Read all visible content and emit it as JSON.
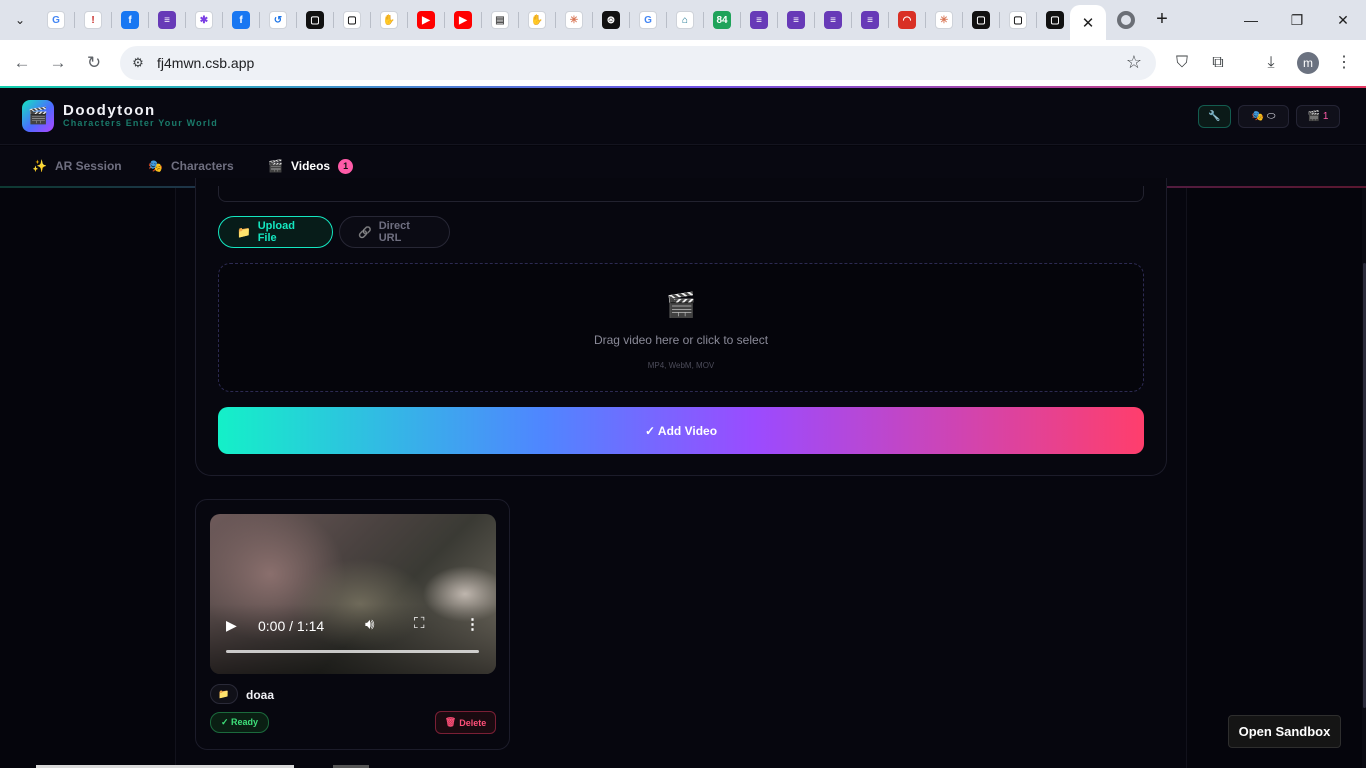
{
  "browser": {
    "tab_icons": [
      {
        "name": "google-icon",
        "glyph": "G",
        "bg": "#ffffff",
        "fg": "#4285f4"
      },
      {
        "name": "alert-icon",
        "glyph": "!",
        "bg": "#ffffff",
        "fg": "#c5221f"
      },
      {
        "name": "facebook-icon",
        "glyph": "f",
        "bg": "#1877f2",
        "fg": "#ffffff"
      },
      {
        "name": "forms-icon",
        "glyph": "≡",
        "bg": "#673ab7",
        "fg": "#ffffff"
      },
      {
        "name": "bug-icon",
        "glyph": "✱",
        "bg": "#ffffff",
        "fg": "#7b3fe4"
      },
      {
        "name": "facebook-icon",
        "glyph": "f",
        "bg": "#1877f2",
        "fg": "#ffffff"
      },
      {
        "name": "history-icon",
        "glyph": "↺",
        "bg": "#ffffff",
        "fg": "#1a73e8"
      },
      {
        "name": "square-icon",
        "glyph": "▢",
        "bg": "#111111",
        "fg": "#ffffff"
      },
      {
        "name": "square-outline-icon",
        "glyph": "▢",
        "bg": "#ffffff",
        "fg": "#111111"
      },
      {
        "name": "hand-icon",
        "glyph": "✋",
        "bg": "#ffffff",
        "fg": "#111111"
      },
      {
        "name": "youtube-icon",
        "glyph": "▶",
        "bg": "#ff0000",
        "fg": "#ffffff"
      },
      {
        "name": "youtube-icon",
        "glyph": "▶",
        "bg": "#ff0000",
        "fg": "#ffffff"
      },
      {
        "name": "archive-icon",
        "glyph": "▤",
        "bg": "#ffffff",
        "fg": "#555555"
      },
      {
        "name": "hand-icon",
        "glyph": "✋",
        "bg": "#ffffff",
        "fg": "#111111"
      },
      {
        "name": "claude-icon",
        "glyph": "✳",
        "bg": "#ffffff",
        "fg": "#d97757"
      },
      {
        "name": "openai-icon",
        "glyph": "⊛",
        "bg": "#111111",
        "fg": "#ffffff"
      },
      {
        "name": "google-icon",
        "glyph": "G",
        "bg": "#ffffff",
        "fg": "#4285f4"
      },
      {
        "name": "graduation-icon",
        "glyph": "⌂",
        "bg": "#ffffff",
        "fg": "#0f6e8c"
      },
      {
        "name": "count-icon",
        "glyph": "84",
        "bg": "#1fa35a",
        "fg": "#ffffff"
      },
      {
        "name": "forms-icon",
        "glyph": "≡",
        "bg": "#673ab7",
        "fg": "#ffffff"
      },
      {
        "name": "forms-icon",
        "glyph": "≡",
        "bg": "#673ab7",
        "fg": "#ffffff"
      },
      {
        "name": "forms-icon",
        "glyph": "≡",
        "bg": "#673ab7",
        "fg": "#ffffff"
      },
      {
        "name": "forms-icon",
        "glyph": "≡",
        "bg": "#673ab7",
        "fg": "#ffffff"
      },
      {
        "name": "wifi-icon",
        "glyph": "◠",
        "bg": "#d93025",
        "fg": "#ffffff"
      },
      {
        "name": "claude-icon",
        "glyph": "✳",
        "bg": "#ffffff",
        "fg": "#d97757"
      },
      {
        "name": "square-icon",
        "glyph": "▢",
        "bg": "#111111",
        "fg": "#ffffff"
      },
      {
        "name": "square-outline-icon",
        "glyph": "▢",
        "bg": "#ffffff",
        "fg": "#111111"
      },
      {
        "name": "square-icon",
        "glyph": "▢",
        "bg": "#111111",
        "fg": "#ffffff"
      }
    ],
    "active_tab_close": "✕",
    "new_tab": "+",
    "minimize": "—",
    "restore": "❐",
    "close": "✕",
    "url": "fj4mwn.csb.app",
    "profile_initial": "m"
  },
  "app": {
    "logo_glyph": "🎬",
    "brand": "Doodytoon",
    "tagline": "Characters Enter Your World",
    "header_pills": [
      {
        "name": "header-wrench-pill",
        "text": "🔧",
        "style": "teal"
      },
      {
        "name": "header-characters-pill",
        "text": "🎭 ⬭",
        "style": ""
      },
      {
        "name": "header-videos-pill",
        "text": "🎬 1",
        "style": ""
      }
    ],
    "tabs": [
      {
        "icon": "✨",
        "label": "AR Session"
      },
      {
        "icon": "🎭",
        "label": "Characters"
      },
      {
        "icon": "🎬",
        "label": "Videos",
        "badge": "1"
      }
    ],
    "upload_file_label": "Upload File",
    "upload_file_icon": "📁",
    "direct_url_label": "Direct URL",
    "direct_url_icon": "🔗",
    "dropzone_icon": "🎬",
    "dropzone_text": "Drag video here or click to select",
    "dropzone_formats": "MP4, WebM, MOV",
    "add_video_label": "✓ Add Video",
    "video_card": {
      "time": "0:00 / 1:14",
      "progress": 0,
      "folder_icon": "📁",
      "name": "doaa",
      "status": "✓ Ready",
      "delete_icon": "🗑",
      "delete_label": "Delete"
    },
    "open_sandbox": "Open Sandbox"
  },
  "colors": {
    "accent_teal": "#14e6c0",
    "accent_purple": "#9b4bff",
    "accent_pink": "#ff3e6c",
    "ready_green": "#3ee07a",
    "delete_red": "#ff4f78"
  }
}
